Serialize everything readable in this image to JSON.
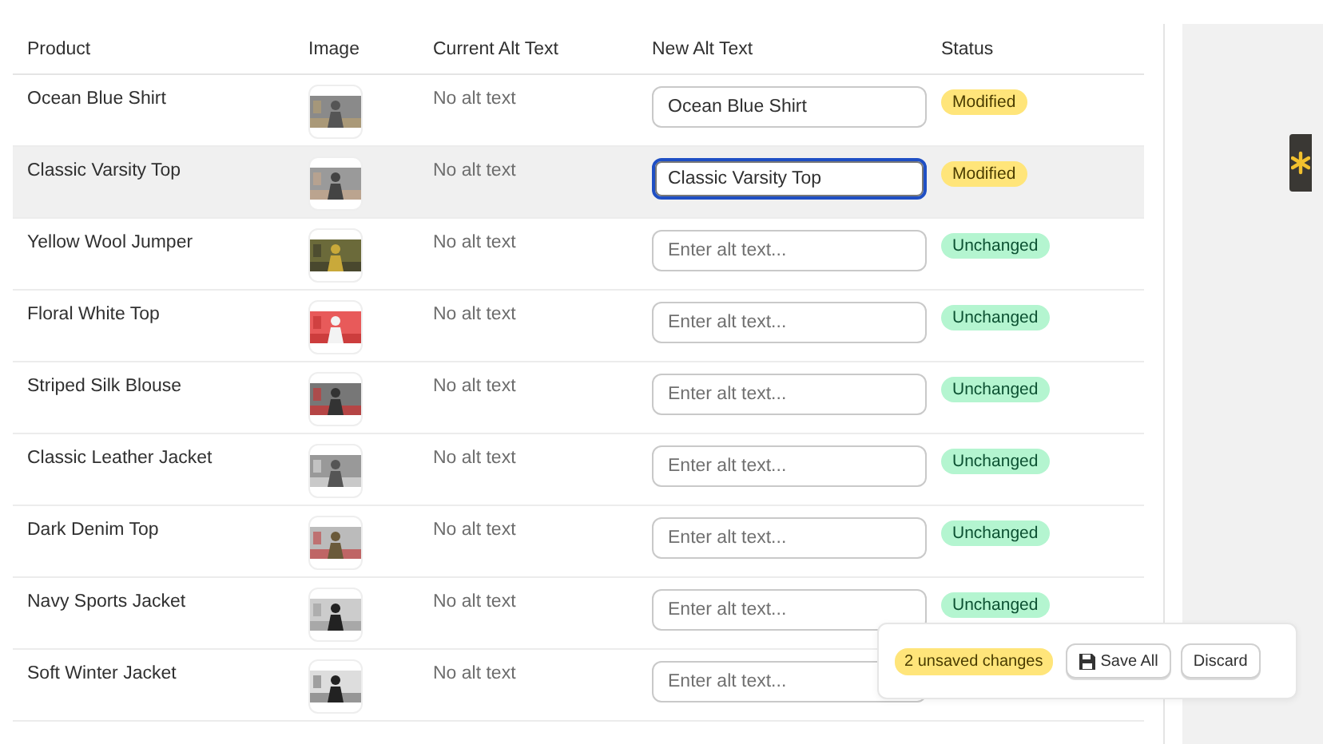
{
  "table": {
    "columns": [
      "Product",
      "Image",
      "Current Alt Text",
      "New Alt Text",
      "Status"
    ],
    "rows": [
      {
        "product": "Ocean Blue Shirt",
        "current_alt": "No alt text",
        "new_alt": {
          "value": "Ocean Blue Shirt",
          "focused": false
        },
        "highlighted": false,
        "status": {
          "kind": "modified",
          "label": "Modified"
        }
      },
      {
        "product": "Classic Varsity Top",
        "current_alt": "No alt text",
        "new_alt": {
          "value": "Classic Varsity Top",
          "focused": true
        },
        "highlighted": true,
        "status": {
          "kind": "modified",
          "label": "Modified"
        }
      },
      {
        "product": "Yellow Wool Jumper",
        "current_alt": "No alt text",
        "new_alt": {
          "placeholder": "Enter alt text...",
          "focused": false
        },
        "highlighted": false,
        "status": {
          "kind": "unchanged",
          "label": "Unchanged"
        }
      },
      {
        "product": "Floral White Top",
        "current_alt": "No alt text",
        "new_alt": {
          "placeholder": "Enter alt text...",
          "focused": false
        },
        "highlighted": false,
        "status": {
          "kind": "unchanged",
          "label": "Unchanged"
        }
      },
      {
        "product": "Striped Silk Blouse",
        "current_alt": "No alt text",
        "new_alt": {
          "placeholder": "Enter alt text...",
          "focused": false
        },
        "highlighted": false,
        "status": {
          "kind": "unchanged",
          "label": "Unchanged"
        }
      },
      {
        "product": "Classic Leather Jacket",
        "current_alt": "No alt text",
        "new_alt": {
          "placeholder": "Enter alt text...",
          "focused": false
        },
        "highlighted": false,
        "status": {
          "kind": "unchanged",
          "label": "Unchanged"
        }
      },
      {
        "product": "Dark Denim Top",
        "current_alt": "No alt text",
        "new_alt": {
          "placeholder": "Enter alt text...",
          "focused": false
        },
        "highlighted": false,
        "status": {
          "kind": "unchanged",
          "label": "Unchanged"
        }
      },
      {
        "product": "Navy Sports Jacket",
        "current_alt": "No alt text",
        "new_alt": {
          "placeholder": "Enter alt text...",
          "focused": false
        },
        "highlighted": false,
        "status": {
          "kind": "unchanged",
          "label": "Unchanged"
        }
      },
      {
        "product": "Soft Winter Jacket",
        "current_alt": "No alt text",
        "new_alt": {
          "placeholder": "Enter alt text...",
          "focused": false
        },
        "highlighted": false
      }
    ]
  },
  "save_bar": {
    "count": "2 unsaved changes",
    "save_button": "Save All",
    "discard_button": "Discard"
  }
}
